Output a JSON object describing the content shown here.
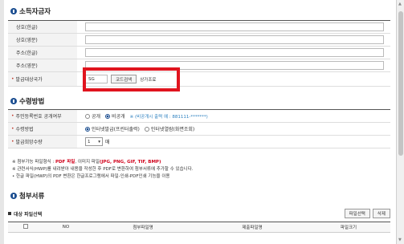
{
  "sections": {
    "owner": {
      "title": "소득자금자"
    },
    "method": {
      "title": "수령방법"
    },
    "attach": {
      "title": "첨부서류"
    }
  },
  "owner_rows": [
    {
      "label": "상호(한글)",
      "value": ""
    },
    {
      "label": "상호(영문)",
      "value": ""
    },
    {
      "label": "주소(한글)",
      "value": ""
    },
    {
      "label": "주소(영문)",
      "value": ""
    }
  ],
  "country_row": {
    "label": "발급대상국가",
    "code_value": "SG",
    "search_button": "코드검색",
    "status_text": "상가조료"
  },
  "method_rows": {
    "disclose": {
      "label": "주민등록번호 공개여부",
      "opt_public": "공개",
      "opt_private": "비공개",
      "selected": "비공개",
      "hint": "※ (비공개시 출력 예 : 881111-*******)"
    },
    "receive": {
      "label": "수령방법",
      "opt_online": "인터넷발급(프린터출력)",
      "opt_view": "인터넷열람(화면조회)",
      "selected": "인터넷발급(프린터출력)"
    },
    "quantity": {
      "label": "발급희망수량",
      "value": "1",
      "unit": "매"
    }
  },
  "notes": {
    "line1_prefix": "※ 첨부가능 파일형식 :",
    "line1_pdf": "PDF 파일",
    "line1_mid": ", 이미지 파일",
    "line1_types": "(JPG, PNG, GIF, TIF, BMP)",
    "line2": "※ 관련서식(HWP)를 내려받아 내용을 작성한 후 PDF로 변환하여 첨부서류에 추가할 수 있습니다.",
    "line3": "• 한글 파일(HWP)의 PDF 변환은 한글프로그램에서 파일-인쇄-PDF인쇄 기능을 이용"
  },
  "file_bar": {
    "title": "대상 파일선택",
    "select_button": "파일선택",
    "delete_button": "삭제"
  },
  "file_table": {
    "columns": [
      "NO",
      "첨부파일명",
      "제출파일명",
      "파일크기"
    ]
  }
}
